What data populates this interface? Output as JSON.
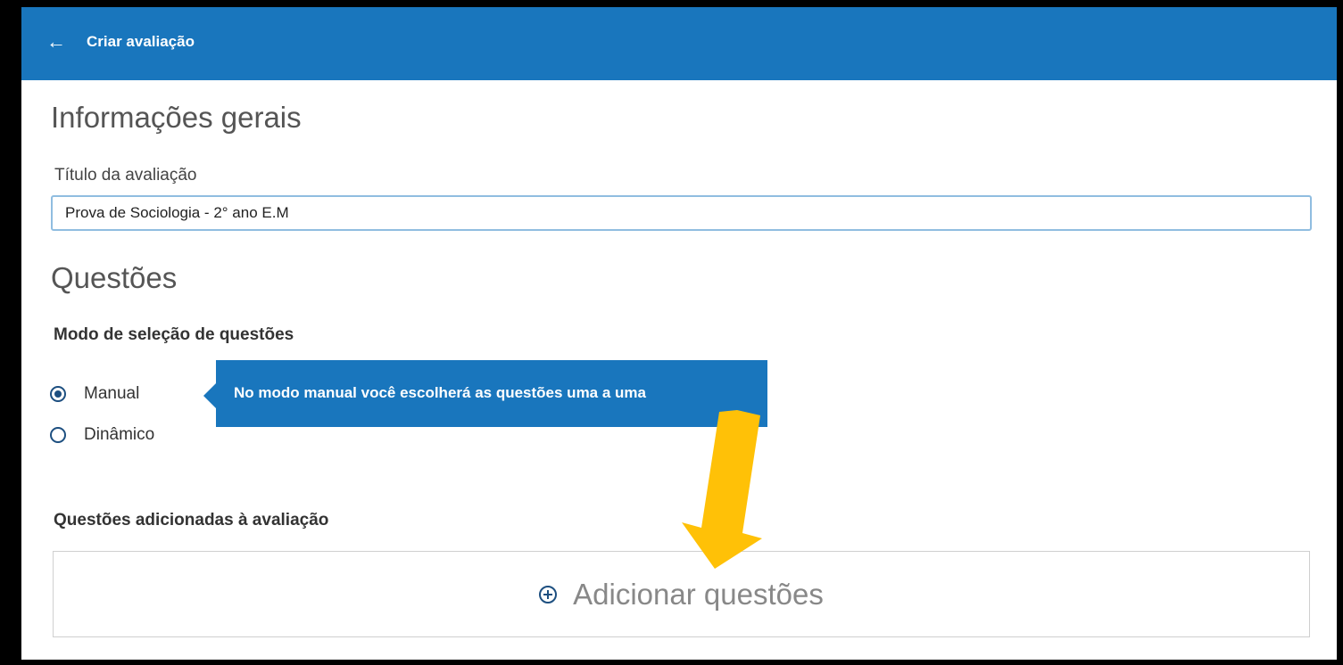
{
  "header": {
    "back_icon": "←",
    "title": "Criar avaliação"
  },
  "general": {
    "heading": "Informações gerais",
    "title_label": "Título da avaliação",
    "title_value": "Prova de Sociologia - 2° ano E.M"
  },
  "questions": {
    "heading": "Questões",
    "mode_label": "Modo de seleção de questões",
    "options": [
      {
        "label": "Manual",
        "selected": true
      },
      {
        "label": "Dinâmico",
        "selected": false
      }
    ],
    "tooltip": "No modo manual você escolherá as questões uma a uma",
    "added_label": "Questões adicionadas à avaliação",
    "add_button": "Adicionar questões"
  },
  "colors": {
    "primary": "#1976bd",
    "annotation_arrow": "#ffc107"
  }
}
